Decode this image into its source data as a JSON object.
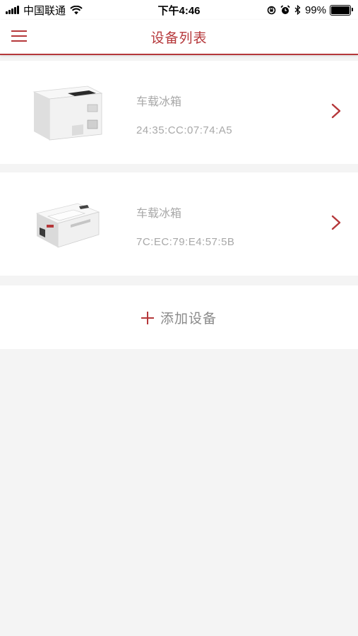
{
  "status_bar": {
    "carrier": "中国联通",
    "time": "下午4:46",
    "battery_text": "99%",
    "battery_level": 0.99
  },
  "nav": {
    "title": "设备列表",
    "accent_color": "#b5373a"
  },
  "devices": [
    {
      "name": "车载冰箱",
      "mac": "24:35:CC:07:74:A5",
      "image": "car-fridge-upright"
    },
    {
      "name": "车载冰箱",
      "mac": "7C:EC:79:E4:57:5B",
      "image": "car-fridge-chest"
    }
  ],
  "add_device": {
    "label": "添加设备",
    "icon": "plus-icon"
  },
  "icons": [
    "menu-icon",
    "chevron-right-icon",
    "wifi-icon",
    "alarm-icon",
    "bluetooth-icon",
    "orientation-lock-icon"
  ]
}
